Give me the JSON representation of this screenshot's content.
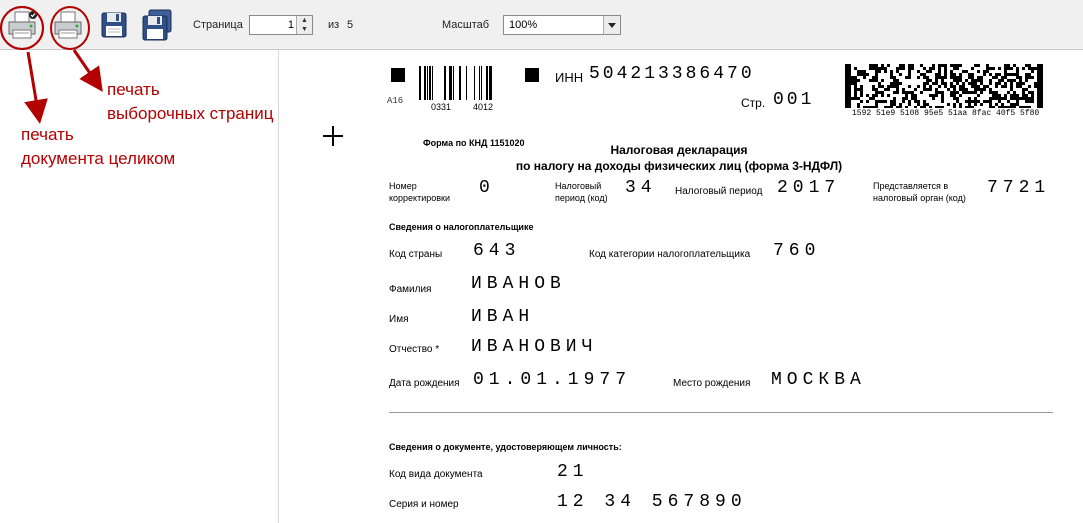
{
  "toolbar": {
    "buttons": [
      {
        "icon": "printer-icon"
      },
      {
        "icon": "printer-icon"
      },
      {
        "icon": "floppy-disk-icon"
      },
      {
        "icon": "floppy-disk-multiple-icon"
      }
    ],
    "page_label": "Страница",
    "page_value": "1",
    "of_label": "из",
    "total_pages": "5",
    "zoom_label": "Масштаб",
    "zoom_value": "100%"
  },
  "annotations": {
    "print_selected_line1": "печать",
    "print_selected_line2": "выборочных страниц",
    "print_all_line1": "печать",
    "print_all_line2": "документа целиком",
    "color": "#b30000"
  },
  "document": {
    "code_a16": "A16",
    "barcode1_num1": "0331",
    "barcode1_num2": "4012",
    "inn_label": "ИНН",
    "inn_value": "504213386470",
    "page_label": "Стр.",
    "page_value": "001",
    "barcode2_text": "1592 51e9 5108 95e5 51aa 8fac 40f5 5f80",
    "form_code": "Форма по КНД 1151020",
    "title_line1": "Налоговая декларация",
    "title_line2": "по налогу на доходы физических лиц (форма 3-НДФЛ)",
    "corr_label_1": "Номер",
    "corr_label_2": "корректировки",
    "corr_value": "0",
    "taxperiod_code_label_1": "Налоговый",
    "taxperiod_code_label_2": "период (код)",
    "taxperiod_code_value": "34",
    "taxperiod_label": "Налоговый период",
    "taxperiod_value": "2017",
    "authority_label_1": "Представляется в",
    "authority_label_2": "налоговый орган (код)",
    "authority_value": "7721",
    "section_taxpayer": "Сведения о налогоплательщике",
    "country_label": "Код страны",
    "country_value": "643",
    "category_label": "Код категории налогоплательщика",
    "category_value": "760",
    "surname_label": "Фамилия",
    "surname_value": "ИВАНОВ",
    "name_label": "Имя",
    "name_value": "ИВАН",
    "patronymic_label": "Отчество *",
    "patronymic_value": "ИВАНОВИЧ",
    "birthdate_label": "Дата рождения",
    "birthdate_value": "01.01.1977",
    "birthplace_label": "Место рождения",
    "birthplace_value": "МОСКВА",
    "section_id": "Сведения о документе, удостоверяющем личность:",
    "doctype_label": "Код вида документа",
    "doctype_value": "21",
    "series_label": "Серия и номер",
    "series_value": "12 34 567890"
  }
}
